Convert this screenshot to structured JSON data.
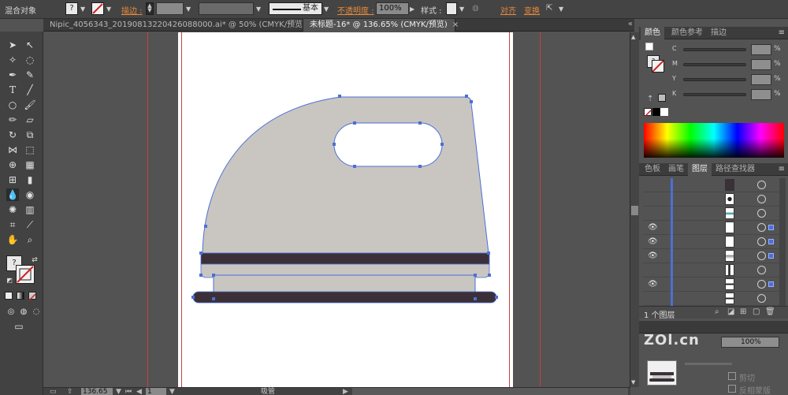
{
  "control_bar": {
    "object_label": "混合对象",
    "question_mark": "?",
    "stroke_label": "描边 :",
    "opacity_label": "不透明度 :",
    "opacity_value": "100%",
    "stroke_profile": "基本",
    "style_label": "样式 :",
    "align_label": "对齐",
    "transform_label": "变换"
  },
  "tabs": [
    {
      "label": "Nipic_4056343_20190813220426088000.ai* @ 50% (CMYK/预览)",
      "close": "×"
    },
    {
      "label": "未标题-16* @ 136.65% (CMYK/预览)",
      "close": "×"
    }
  ],
  "status_bar": {
    "zoom": "136.65",
    "page": "1",
    "status": "吸管"
  },
  "color_panel": {
    "tabs": [
      "颜色",
      "颜色参考",
      "描边"
    ],
    "channels": [
      {
        "label": "C",
        "unit": "%"
      },
      {
        "label": "M",
        "unit": "%"
      },
      {
        "label": "Y",
        "unit": "%"
      },
      {
        "label": "K",
        "unit": "%"
      }
    ]
  },
  "layers_panel": {
    "tabs": [
      "色板",
      "画笔",
      "图层",
      "路径查找器"
    ],
    "footer_label": "1 个图层"
  },
  "lower_panel": {
    "opacity_value": "100%",
    "item1": "剪切",
    "item2": "反相蒙版"
  },
  "watermark": {
    "text": "ZOl.cn"
  },
  "colors": {
    "iron_body": "#c9c6c1",
    "iron_band": "#3b3038",
    "artboard": "#ffffff",
    "selection": "#4c6fd6",
    "guide": "#c84040"
  }
}
